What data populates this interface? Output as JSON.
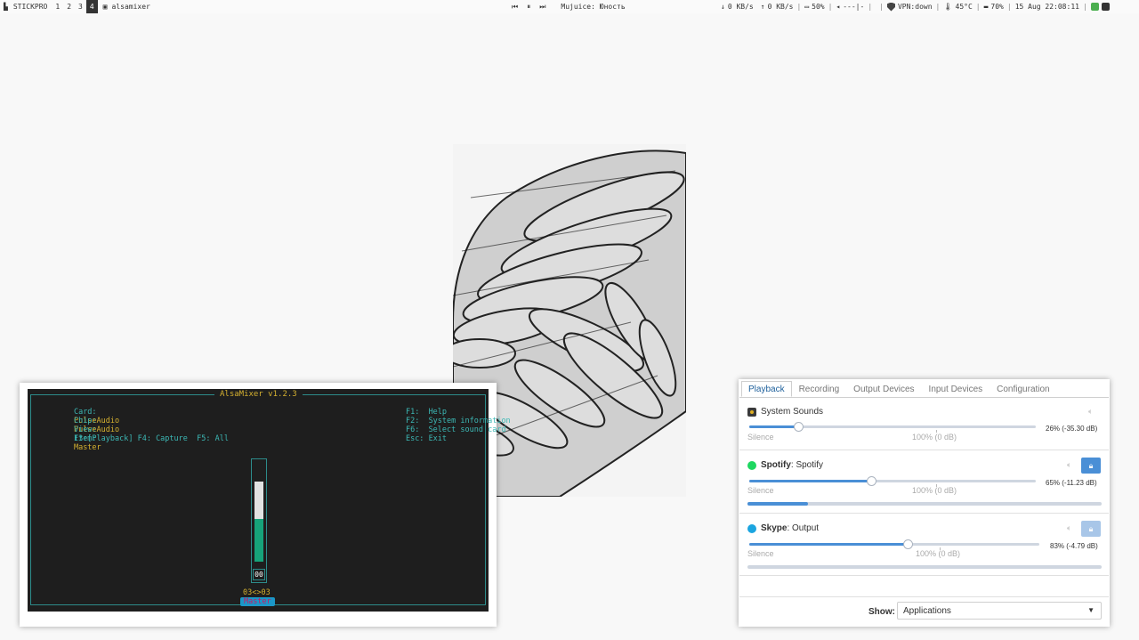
{
  "topbar": {
    "workspace_name": "STICKPRO",
    "workspaces": [
      "1",
      "2",
      "3",
      "4"
    ],
    "active_workspace": "4",
    "window_title": "alsamixer",
    "now_playing": "Mujuice: Юность",
    "net_down": "0 KB/s",
    "net_up": "0 KB/s",
    "brightness": "50%",
    "volume_bar": "---|-",
    "vpn": "VPN:down",
    "temperature": "45°C",
    "battery": "70%",
    "datetime": "15 Aug 22:08:11"
  },
  "alsamixer": {
    "title": "AlsaMixer v1.2.3",
    "card_label": "Card:",
    "card_value": "PulseAudio",
    "chip_label": "Chip:",
    "chip_value": "PulseAudio",
    "view_label": "View:",
    "view_value": "F3:[Playback] F4: Capture  F5: All",
    "item_label": "Item:",
    "item_value": "Master",
    "help_lines": [
      {
        "key": "F1:",
        "text": "Help"
      },
      {
        "key": "F2:",
        "text": "System information"
      },
      {
        "key": "F6:",
        "text": "Select sound card"
      },
      {
        "key": "Esc:",
        "text": "Exit"
      }
    ],
    "channel_cap": "00",
    "channel_value": "03<>03",
    "channel_name": "Master",
    "channel_level": 0.59
  },
  "pavucontrol": {
    "tabs": [
      "Playback",
      "Recording",
      "Output Devices",
      "Input Devices",
      "Configuration"
    ],
    "active_tab": "Playback",
    "streams": [
      {
        "app": "System Sounds",
        "device": "",
        "icon": "system-sounds-icon",
        "icon_color": "#3a3a3a",
        "level_pct": 26,
        "level_text": "26% (-35.30 dB)",
        "silence": "Silence",
        "reference": "100% (0 dB)",
        "has_lock": false,
        "meter_fraction": null
      },
      {
        "app": "Spotify",
        "device": ": Spotify",
        "icon": "spotify-icon",
        "icon_color": "#1ed760",
        "level_pct": 65,
        "level_text": "65% (-11.23 dB)",
        "silence": "Silence",
        "reference": "100% (0 dB)",
        "has_lock": true,
        "lock_enabled": true,
        "meter_fraction": 0.17
      },
      {
        "app": "Skype",
        "device": ": Output",
        "icon": "skype-icon",
        "icon_color": "#1ba5e0",
        "level_pct": 83,
        "level_text": "83% (-4.79 dB)",
        "silence": "Silence",
        "reference": "100% (0 dB)",
        "has_lock": true,
        "lock_enabled": false,
        "meter_fraction": 0
      }
    ],
    "show_label": "Show:",
    "show_value": "Applications"
  },
  "colors": {
    "accent": "#4a8fd6",
    "terminal_bg": "#1e1e1e",
    "terminal_cyan": "#3cb8b5",
    "terminal_yellow": "#d4b030"
  }
}
